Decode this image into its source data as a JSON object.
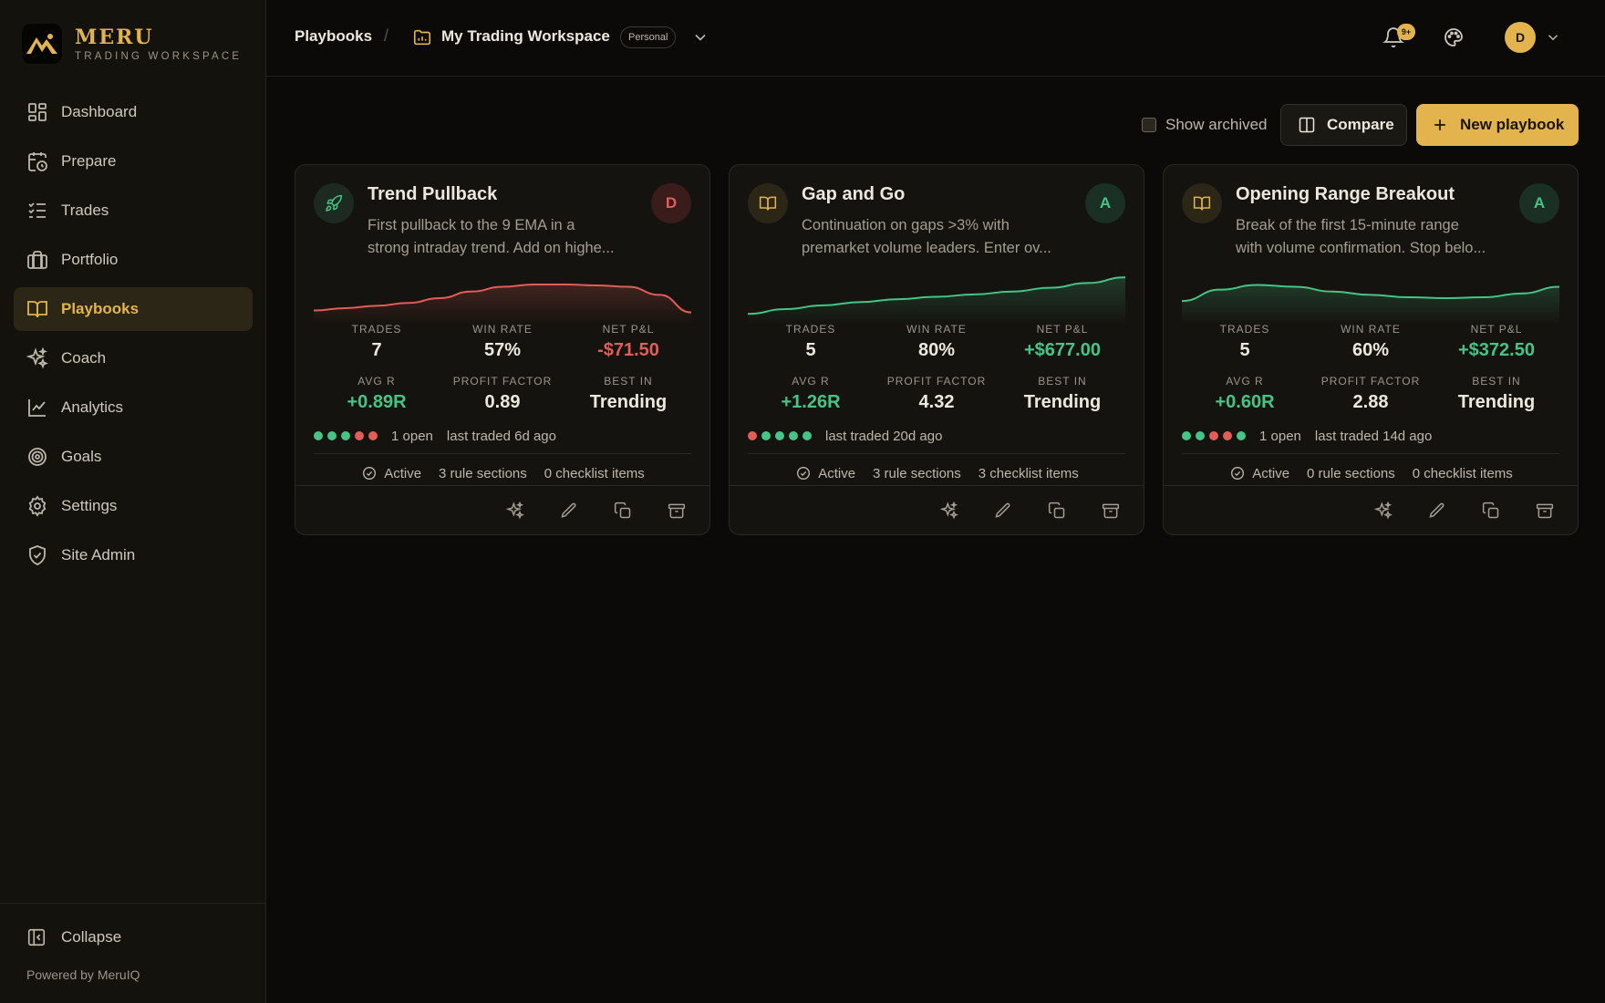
{
  "brand": {
    "name": "MERU",
    "subtitle": "TRADING WORKSPACE"
  },
  "sidebar": {
    "items": [
      {
        "label": "Dashboard",
        "icon": "dashboard-icon",
        "active": false
      },
      {
        "label": "Prepare",
        "icon": "calendar-clock-icon",
        "active": false
      },
      {
        "label": "Trades",
        "icon": "list-check-icon",
        "active": false
      },
      {
        "label": "Portfolio",
        "icon": "briefcase-icon",
        "active": false
      },
      {
        "label": "Playbooks",
        "icon": "book-icon",
        "active": true
      },
      {
        "label": "Coach",
        "icon": "sparkles-icon",
        "active": false
      },
      {
        "label": "Analytics",
        "icon": "line-chart-icon",
        "active": false
      },
      {
        "label": "Goals",
        "icon": "target-icon",
        "active": false
      },
      {
        "label": "Settings",
        "icon": "gear-icon",
        "active": false
      },
      {
        "label": "Site Admin",
        "icon": "shield-check-icon",
        "active": false
      }
    ],
    "collapse_label": "Collapse",
    "powered_by": "Powered by MeruIQ"
  },
  "header": {
    "breadcrumb": "Playbooks",
    "separator": "/",
    "workspace_name": "My Trading Workspace",
    "workspace_badge": "Personal",
    "notification_count": "9+",
    "avatar_initial": "D"
  },
  "toolbar": {
    "show_archived_label": "Show archived",
    "show_archived_checked": false,
    "compare_label": "Compare",
    "new_playbook_label": "New playbook"
  },
  "stat_labels": {
    "trades": "TRADES",
    "win_rate": "WIN RATE",
    "net_pnl": "NET P&L",
    "avg_r": "AVG R",
    "profit_factor": "PROFIT FACTOR",
    "best_in": "BEST IN"
  },
  "playbooks": [
    {
      "title": "Trend Pullback",
      "icon": "rocket-icon",
      "desc_line1": "First pullback to the 9 EMA in a",
      "desc_line2": "strong intraday trend. Add on highe...",
      "grade": "D",
      "trades": "7",
      "win_rate": "57%",
      "net_pnl": "-$71.50",
      "avg_r": "+0.89R",
      "profit_factor": "0.89",
      "best_in": "Trending",
      "recent_results": [
        "win",
        "win",
        "win",
        "loss",
        "loss"
      ],
      "open_text": "1 open",
      "last_traded": "last traded 6d ago",
      "status": "Active",
      "rule_sections": "3 rule sections",
      "checklist_items": "0 checklist items",
      "sparkline_color": "#e35d57",
      "sparkline": [
        0.22,
        0.27,
        0.32,
        0.38,
        0.48,
        0.62,
        0.72,
        0.77,
        0.77,
        0.75,
        0.72,
        0.55,
        0.18
      ]
    },
    {
      "title": "Gap and Go",
      "icon": "book-icon",
      "desc_line1": "Continuation on gaps >3% with",
      "desc_line2": "premarket volume leaders. Enter ov...",
      "grade": "A",
      "trades": "5",
      "win_rate": "80%",
      "net_pnl": "+$677.00",
      "avg_r": "+1.26R",
      "profit_factor": "4.32",
      "best_in": "Trending",
      "recent_results": [
        "loss",
        "win",
        "win",
        "win",
        "win"
      ],
      "open_text": "",
      "last_traded": "last traded 20d ago",
      "status": "Active",
      "rule_sections": "3 rule sections",
      "checklist_items": "3 checklist items",
      "sparkline_color": "#46c485",
      "sparkline": [
        0.15,
        0.25,
        0.33,
        0.4,
        0.46,
        0.51,
        0.56,
        0.62,
        0.7,
        0.8,
        0.92
      ]
    },
    {
      "title": "Opening Range Breakout",
      "icon": "book-icon",
      "desc_line1": "Break of the first 15-minute range",
      "desc_line2": "with volume confirmation. Stop belo...",
      "grade": "A",
      "trades": "5",
      "win_rate": "60%",
      "net_pnl": "+$372.50",
      "avg_r": "+0.60R",
      "profit_factor": "2.88",
      "best_in": "Trending",
      "recent_results": [
        "win",
        "win",
        "loss",
        "loss",
        "win"
      ],
      "open_text": "1 open",
      "last_traded": "last traded 14d ago",
      "status": "Active",
      "rule_sections": "0 rule sections",
      "checklist_items": "0 checklist items",
      "sparkline_color": "#46c485",
      "sparkline": [
        0.42,
        0.66,
        0.76,
        0.72,
        0.62,
        0.55,
        0.5,
        0.48,
        0.5,
        0.58,
        0.72
      ]
    }
  ]
}
